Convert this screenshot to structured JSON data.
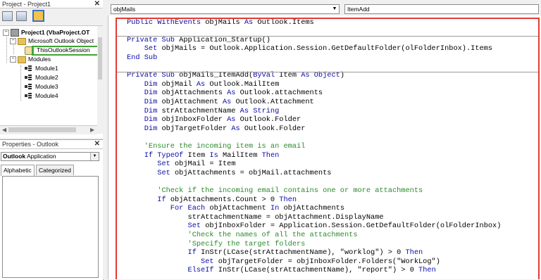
{
  "project_panel": {
    "title": "Project - Project1",
    "close_label": "✕",
    "tree": {
      "root": "Project1 (VbaProject.OT",
      "folder1": "Microsoft Outlook Object",
      "session": "ThisOutlookSession",
      "folder2": "Modules",
      "modules": [
        "Module1",
        "Module2",
        "Module3",
        "Module4"
      ]
    }
  },
  "properties_panel": {
    "title": "Properties - Outlook",
    "close_label": "✕",
    "object_name": "Outlook",
    "object_type": "Application",
    "tabs": [
      "Alphabetic",
      "Categorized"
    ]
  },
  "code_window": {
    "object_combo": "objMails",
    "procedure_combo": "ItemAdd",
    "lines": [
      [
        [
          "kw",
          "Public WithEvents "
        ],
        [
          "",
          "objMails "
        ],
        [
          "kw",
          "As "
        ],
        [
          "",
          "Outlook.Items"
        ]
      ],
      [],
      [
        [
          "kw",
          "Private Sub "
        ],
        [
          "",
          "Application_Startup()"
        ]
      ],
      [
        [
          "",
          "    "
        ],
        [
          "kw",
          "Set "
        ],
        [
          "",
          "objMails = Outlook.Application.Session.GetDefaultFolder(olFolderInbox).Items"
        ]
      ],
      [
        [
          "kw",
          "End Sub"
        ]
      ],
      [],
      [
        [
          "kw",
          "Private Sub "
        ],
        [
          "",
          "objMails_ItemAdd("
        ],
        [
          "kw",
          "ByVal "
        ],
        [
          "",
          "Item "
        ],
        [
          "kw",
          "As Object"
        ],
        [
          "",
          ")"
        ]
      ],
      [
        [
          "",
          "    "
        ],
        [
          "kw",
          "Dim "
        ],
        [
          "",
          "objMail "
        ],
        [
          "kw",
          "As "
        ],
        [
          "",
          "Outlook.MailItem"
        ]
      ],
      [
        [
          "",
          "    "
        ],
        [
          "kw",
          "Dim "
        ],
        [
          "",
          "objAttachments "
        ],
        [
          "kw",
          "As "
        ],
        [
          "",
          "Outlook.attachments"
        ]
      ],
      [
        [
          "",
          "    "
        ],
        [
          "kw",
          "Dim "
        ],
        [
          "",
          "objAttachment "
        ],
        [
          "kw",
          "As "
        ],
        [
          "",
          "Outlook.Attachment"
        ]
      ],
      [
        [
          "",
          "    "
        ],
        [
          "kw",
          "Dim "
        ],
        [
          "",
          "strAttachmentName "
        ],
        [
          "kw",
          "As String"
        ]
      ],
      [
        [
          "",
          "    "
        ],
        [
          "kw",
          "Dim "
        ],
        [
          "",
          "objInboxFolder "
        ],
        [
          "kw",
          "As "
        ],
        [
          "",
          "Outlook.Folder"
        ]
      ],
      [
        [
          "",
          "    "
        ],
        [
          "kw",
          "Dim "
        ],
        [
          "",
          "objTargetFolder "
        ],
        [
          "kw",
          "As "
        ],
        [
          "",
          "Outlook.Folder"
        ]
      ],
      [],
      [
        [
          "",
          "    "
        ],
        [
          "cm",
          "'Ensure the incoming item is an email"
        ]
      ],
      [
        [
          "",
          "    "
        ],
        [
          "kw",
          "If TypeOf "
        ],
        [
          "",
          "Item "
        ],
        [
          "kw",
          "Is "
        ],
        [
          "",
          "MailItem "
        ],
        [
          "kw",
          "Then"
        ]
      ],
      [
        [
          "",
          "       "
        ],
        [
          "kw",
          "Set "
        ],
        [
          "",
          "objMail = Item"
        ]
      ],
      [
        [
          "",
          "       "
        ],
        [
          "kw",
          "Set "
        ],
        [
          "",
          "objAttachments = objMail.attachments"
        ]
      ],
      [],
      [
        [
          "",
          "       "
        ],
        [
          "cm",
          "'Check if the incoming email contains one or more attachments"
        ]
      ],
      [
        [
          "",
          "       "
        ],
        [
          "kw",
          "If "
        ],
        [
          "",
          "objAttachments.Count > 0 "
        ],
        [
          "kw",
          "Then"
        ]
      ],
      [
        [
          "",
          "          "
        ],
        [
          "kw",
          "For Each "
        ],
        [
          "",
          "objAttachment "
        ],
        [
          "kw",
          "In "
        ],
        [
          "",
          "objAttachments"
        ]
      ],
      [
        [
          "",
          "              "
        ],
        [
          "",
          "strAttachmentName = objAttachment.DisplayName"
        ]
      ],
      [
        [
          "",
          "              "
        ],
        [
          "kw",
          "Set "
        ],
        [
          "",
          "objInboxFolder = Application.Session.GetDefaultFolder(olFolderInbox)"
        ]
      ],
      [
        [
          "",
          "              "
        ],
        [
          "cm",
          "'Check the names of all the attachments"
        ]
      ],
      [
        [
          "",
          "              "
        ],
        [
          "cm",
          "'Specify the target folders"
        ]
      ],
      [
        [
          "",
          "              "
        ],
        [
          "kw",
          "If "
        ],
        [
          "",
          "InStr(LCase(strAttachmentName), \"worklog\") > 0 "
        ],
        [
          "kw",
          "Then"
        ]
      ],
      [
        [
          "",
          "                 "
        ],
        [
          "kw",
          "Set "
        ],
        [
          "",
          "objTargetFolder = objInboxFolder.Folders(\"WorkLog\")"
        ]
      ],
      [
        [
          "",
          "              "
        ],
        [
          "kw",
          "ElseIf "
        ],
        [
          "",
          "InStr(LCase(strAttachmentName), \"report\") > 0 "
        ],
        [
          "kw",
          "Then"
        ]
      ]
    ]
  },
  "colors": {
    "highlight_red": "#e03b34",
    "highlight_green": "#3ea534",
    "keyword": "#0a0aa8",
    "comment": "#2a8a2a"
  },
  "icons": [
    "view-code-icon",
    "view-object-icon",
    "toggle-folders-icon",
    "project-icon",
    "folder-icon",
    "module-icon",
    "session-icon"
  ]
}
